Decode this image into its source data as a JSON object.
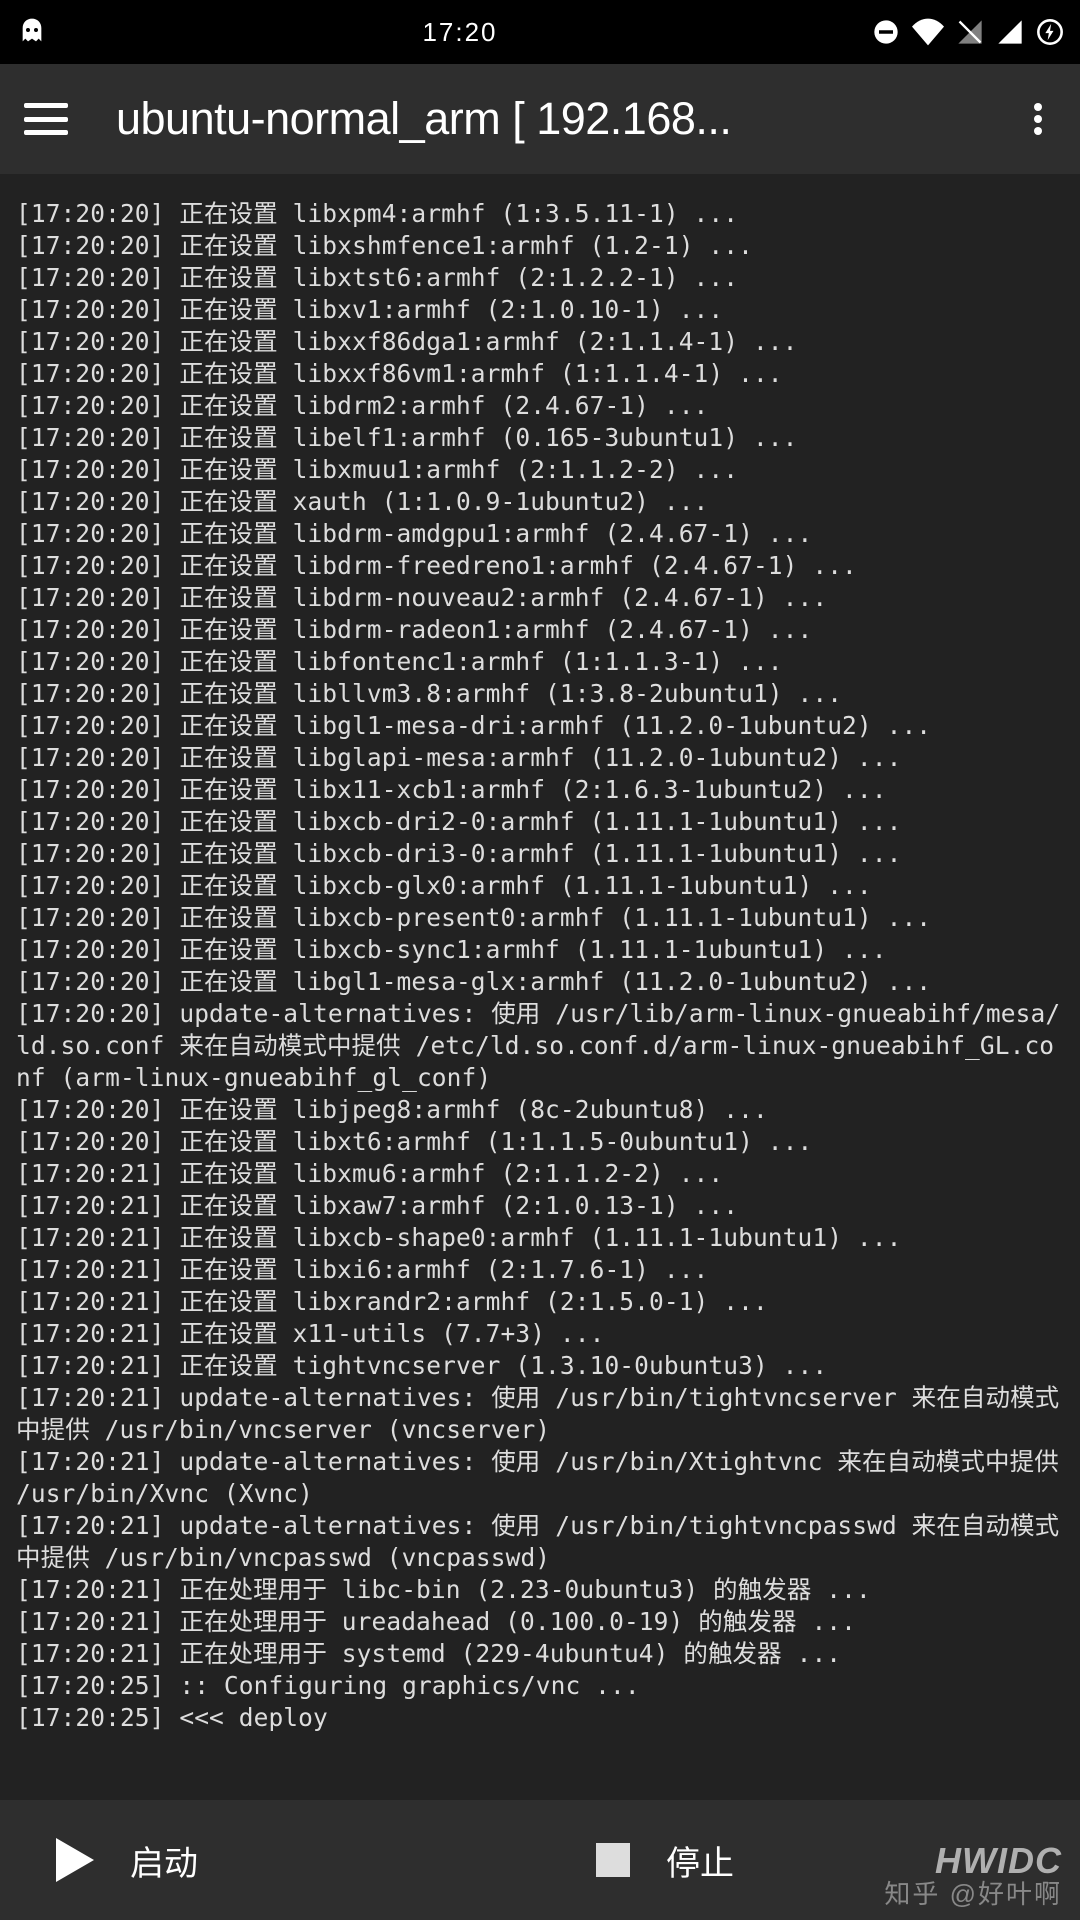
{
  "status_bar": {
    "time": "17:20"
  },
  "app_bar": {
    "title": "ubuntu-normal_arm  [ 192.168..."
  },
  "terminal": {
    "lines": [
      "[17:20:20] 正在设置 libxpm4:armhf (1:3.5.11-1) ...",
      "[17:20:20] 正在设置 libxshmfence1:armhf (1.2-1) ...",
      "[17:20:20] 正在设置 libxtst6:armhf (2:1.2.2-1) ...",
      "[17:20:20] 正在设置 libxv1:armhf (2:1.0.10-1) ...",
      "[17:20:20] 正在设置 libxxf86dga1:armhf (2:1.1.4-1) ...",
      "[17:20:20] 正在设置 libxxf86vm1:armhf (1:1.1.4-1) ...",
      "[17:20:20] 正在设置 libdrm2:armhf (2.4.67-1) ...",
      "[17:20:20] 正在设置 libelf1:armhf (0.165-3ubuntu1) ...",
      "[17:20:20] 正在设置 libxmuu1:armhf (2:1.1.2-2) ...",
      "[17:20:20] 正在设置 xauth (1:1.0.9-1ubuntu2) ...",
      "[17:20:20] 正在设置 libdrm-amdgpu1:armhf (2.4.67-1) ...",
      "[17:20:20] 正在设置 libdrm-freedreno1:armhf (2.4.67-1) ...",
      "[17:20:20] 正在设置 libdrm-nouveau2:armhf (2.4.67-1) ...",
      "[17:20:20] 正在设置 libdrm-radeon1:armhf (2.4.67-1) ...",
      "[17:20:20] 正在设置 libfontenc1:armhf (1:1.1.3-1) ...",
      "[17:20:20] 正在设置 libllvm3.8:armhf (1:3.8-2ubuntu1) ...",
      "[17:20:20] 正在设置 libgl1-mesa-dri:armhf (11.2.0-1ubuntu2) ...",
      "[17:20:20] 正在设置 libglapi-mesa:armhf (11.2.0-1ubuntu2) ...",
      "[17:20:20] 正在设置 libx11-xcb1:armhf (2:1.6.3-1ubuntu2) ...",
      "[17:20:20] 正在设置 libxcb-dri2-0:armhf (1.11.1-1ubuntu1) ...",
      "[17:20:20] 正在设置 libxcb-dri3-0:armhf (1.11.1-1ubuntu1) ...",
      "[17:20:20] 正在设置 libxcb-glx0:armhf (1.11.1-1ubuntu1) ...",
      "[17:20:20] 正在设置 libxcb-present0:armhf (1.11.1-1ubuntu1) ...",
      "[17:20:20] 正在设置 libxcb-sync1:armhf (1.11.1-1ubuntu1) ...",
      "[17:20:20] 正在设置 libgl1-mesa-glx:armhf (11.2.0-1ubuntu2) ...",
      "[17:20:20] update-alternatives: 使用 /usr/lib/arm-linux-gnueabihf/mesa/ld.so.conf 来在自动模式中提供 /etc/ld.so.conf.d/arm-linux-gnueabihf_GL.conf (arm-linux-gnueabihf_gl_conf)",
      "[17:20:20] 正在设置 libjpeg8:armhf (8c-2ubuntu8) ...",
      "[17:20:20] 正在设置 libxt6:armhf (1:1.1.5-0ubuntu1) ...",
      "[17:20:21] 正在设置 libxmu6:armhf (2:1.1.2-2) ...",
      "[17:20:21] 正在设置 libxaw7:armhf (2:1.0.13-1) ...",
      "[17:20:21] 正在设置 libxcb-shape0:armhf (1.11.1-1ubuntu1) ...",
      "[17:20:21] 正在设置 libxi6:armhf (2:1.7.6-1) ...",
      "[17:20:21] 正在设置 libxrandr2:armhf (2:1.5.0-1) ...",
      "[17:20:21] 正在设置 x11-utils (7.7+3) ...",
      "[17:20:21] 正在设置 tightvncserver (1.3.10-0ubuntu3) ...",
      "[17:20:21] update-alternatives: 使用 /usr/bin/tightvncserver 来在自动模式中提供 /usr/bin/vncserver (vncserver)",
      "[17:20:21] update-alternatives: 使用 /usr/bin/Xtightvnc 来在自动模式中提供 /usr/bin/Xvnc (Xvnc)",
      "[17:20:21] update-alternatives: 使用 /usr/bin/tightvncpasswd 来在自动模式中提供 /usr/bin/vncpasswd (vncpasswd)",
      "[17:20:21] 正在处理用于 libc-bin (2.23-0ubuntu3) 的触发器 ...",
      "[17:20:21] 正在处理用于 ureadahead (0.100.0-19) 的触发器 ...",
      "[17:20:21] 正在处理用于 systemd (229-4ubuntu4) 的触发器 ...",
      "[17:20:25] :: Configuring graphics/vnc ...",
      "[17:20:25] <<< deploy"
    ]
  },
  "bottom_bar": {
    "start_label": "启动",
    "stop_label": "停止"
  },
  "watermark": {
    "line1": "HWIDC",
    "line2": "知乎 @好叶啊"
  }
}
